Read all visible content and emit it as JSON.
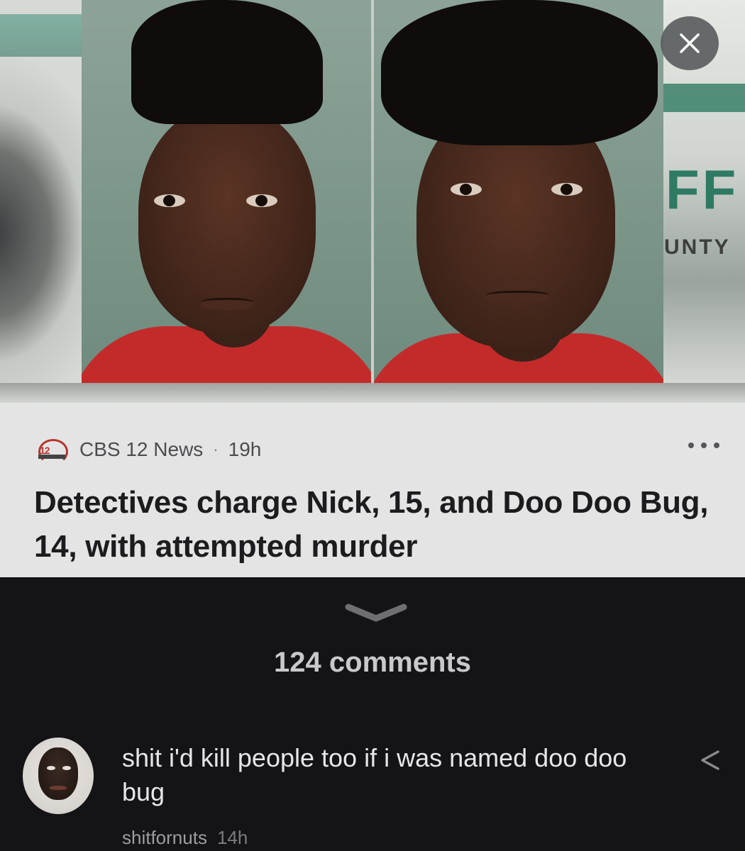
{
  "article": {
    "source_name": "CBS 12 News",
    "separator": "·",
    "age": "19h",
    "headline": "Detectives charge Nick, 15, and Doo Doo Bug, 14, with attempted murder",
    "photo_background_letters": "FF",
    "photo_background_small": "UNTY"
  },
  "icons": {
    "close": "close-icon",
    "more": "more-options-icon",
    "expand": "chevron-down-icon",
    "share": "share-icon"
  },
  "comments": {
    "count_label": "124 comments",
    "items": [
      {
        "text": "shit i'd kill people too if i was named doo doo bug",
        "author": "shitfornuts",
        "age": "14h"
      }
    ]
  },
  "colors": {
    "card_background": "#e4e4e5",
    "dark_background": "#141416",
    "shirt_red": "#c32b2b",
    "accent_green": "#2f7a63"
  }
}
